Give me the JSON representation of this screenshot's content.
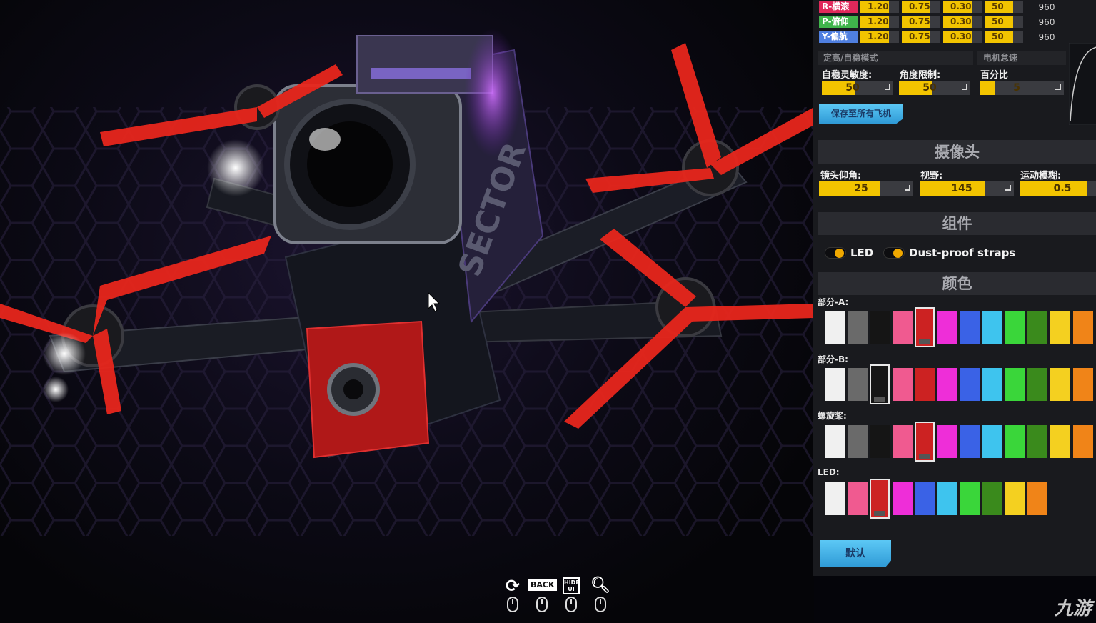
{
  "pid": {
    "rows": [
      {
        "label": "R-横滚",
        "color": "#e0285a",
        "p": "1.20",
        "i": "0.75",
        "d": "0.30",
        "f": "50",
        "rate": "960"
      },
      {
        "label": "P-俯仰",
        "color": "#3fb54b",
        "p": "1.20",
        "i": "0.75",
        "d": "0.30",
        "f": "50",
        "rate": "960"
      },
      {
        "label": "Y-偏航",
        "color": "#4f7fe0",
        "p": "1.20",
        "i": "0.75",
        "d": "0.30",
        "f": "50",
        "rate": "960"
      }
    ]
  },
  "stabilize": {
    "header": "定高/自稳模式",
    "motor_header": "电机怠速",
    "sensitivity_label": "自稳灵敏度:",
    "sensitivity_value": "50",
    "sensitivity_fill": 0.55,
    "angle_label": "角度限制:",
    "angle_value": "50",
    "angle_fill": 0.55,
    "percent_label": "百分比",
    "percent_value": "5",
    "percent_fill": 0.2,
    "save_all_label": "保存至所有飞机"
  },
  "camera": {
    "header": "摄像头",
    "tilt_label": "镜头仰角:",
    "tilt_value": "25",
    "tilt_fill": 0.72,
    "fov_label": "视野:",
    "fov_value": "145",
    "fov_fill": 0.78,
    "blur_label": "运动模糊:",
    "blur_value": "0.5",
    "blur_fill": 1.0
  },
  "components": {
    "header": "组件",
    "led_label": "LED",
    "straps_label": "Dust-proof straps"
  },
  "colors": {
    "header": "颜色",
    "palette": [
      "#f0f0f0",
      "#6a6a6a",
      "#151515",
      "#f05a90",
      "#cc2222",
      "#ee2ed8",
      "#3a62e6",
      "#3ec4ee",
      "#3ad63a",
      "#3a8a1c",
      "#f4d020",
      "#f08418"
    ],
    "led_palette": [
      "#f0f0f0",
      "#f05a90",
      "#cc2222",
      "#ee2ed8",
      "#3a62e6",
      "#3ec4ee",
      "#3ad63a",
      "#3a8a1c",
      "#f4d020",
      "#f08418"
    ],
    "part_a_label": "部分-A:",
    "part_a_selected": 4,
    "part_b_label": "部分-B:",
    "part_b_selected": 2,
    "prop_label": "螺旋桨:",
    "prop_selected": 4,
    "led_label": "LED:",
    "led_selected": 2
  },
  "default_label": "默认",
  "drone_text": "SECTOR",
  "toolbar": {
    "rotate_icon": "rotate-icon",
    "back_label": "BACK",
    "hide_ui_label": "HIDE UI",
    "zoom_icon": "zoom-icon"
  },
  "watermark": "九游"
}
